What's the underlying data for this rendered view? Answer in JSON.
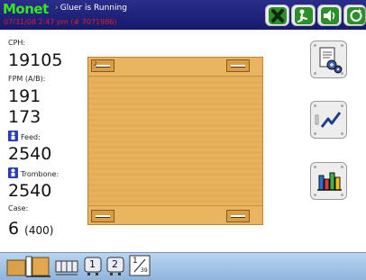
{
  "header": {
    "logo": "Monet",
    "status": "Gluer is Running",
    "datetime": "07/31/08  2:47 pm  (# 7071986)",
    "icons": [
      "stop-x-icon",
      "operator-run-icon",
      "speaker-volume-icon",
      "refresh-cycle-icon"
    ]
  },
  "readouts": {
    "cph_label": "CPH:",
    "cph_value": "19105",
    "fpm_label": "FPM (A/B):",
    "fpm_a": "191",
    "fpm_b": "173",
    "feed_label": "Feed:",
    "feed_value": "2540",
    "trombone_label": "Trombone:",
    "trombone_value": "2540",
    "case_label": "Case:",
    "case_value": "6",
    "case_total": "(400)"
  },
  "machine": {
    "grip_top_left_label": "2"
  },
  "side_buttons": [
    "settings-document-gears-icon",
    "trend-graph-icon",
    "bar-chart-icon"
  ],
  "footer": {
    "icons": [
      "machine-layout-icon",
      "carton-diagram-icon",
      "unit-1-icon",
      "unit-2-icon",
      "fraction-scale-icon"
    ],
    "unit1": "1",
    "unit2": "2",
    "scale_top": "1",
    "scale_bottom": "39"
  },
  "colors": {
    "header_bg": "#1c1f77",
    "logo_green": "#39e51c",
    "datetime_red": "#e01e1e",
    "board": "#e9b45f",
    "footer_bg": "#a6c6e8"
  }
}
